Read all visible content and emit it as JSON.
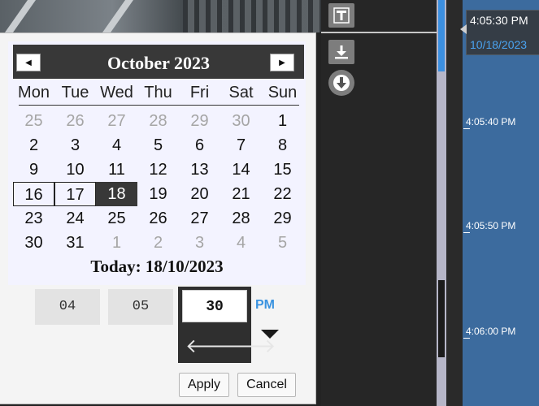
{
  "calendar": {
    "month_title": "October 2023",
    "prev_symbol": "◀",
    "next_symbol": "▶",
    "weekdays": [
      "Mon",
      "Tue",
      "Wed",
      "Thu",
      "Fri",
      "Sat",
      "Sun"
    ],
    "weeks": [
      [
        {
          "d": "25",
          "o": true
        },
        {
          "d": "26",
          "o": true
        },
        {
          "d": "27",
          "o": true
        },
        {
          "d": "28",
          "o": true
        },
        {
          "d": "29",
          "o": true
        },
        {
          "d": "30",
          "o": true
        },
        {
          "d": "1"
        }
      ],
      [
        {
          "d": "2"
        },
        {
          "d": "3"
        },
        {
          "d": "4"
        },
        {
          "d": "5"
        },
        {
          "d": "6"
        },
        {
          "d": "7"
        },
        {
          "d": "8"
        }
      ],
      [
        {
          "d": "9"
        },
        {
          "d": "10"
        },
        {
          "d": "11"
        },
        {
          "d": "12"
        },
        {
          "d": "13"
        },
        {
          "d": "14"
        },
        {
          "d": "15"
        }
      ],
      [
        {
          "d": "16",
          "h": true
        },
        {
          "d": "17",
          "h": true
        },
        {
          "d": "18",
          "s": true
        },
        {
          "d": "19"
        },
        {
          "d": "20"
        },
        {
          "d": "21"
        },
        {
          "d": "22"
        }
      ],
      [
        {
          "d": "23"
        },
        {
          "d": "24"
        },
        {
          "d": "25"
        },
        {
          "d": "26"
        },
        {
          "d": "27"
        },
        {
          "d": "28"
        },
        {
          "d": "29"
        }
      ],
      [
        {
          "d": "30"
        },
        {
          "d": "31"
        },
        {
          "d": "1",
          "o": true
        },
        {
          "d": "2",
          "o": true
        },
        {
          "d": "3",
          "o": true
        },
        {
          "d": "4",
          "o": true
        },
        {
          "d": "5",
          "o": true
        }
      ]
    ],
    "today_label": "Today: 18/10/2023"
  },
  "time": {
    "hour": "04",
    "minute": "05",
    "second": "30",
    "ampm": "PM",
    "left_arrow": "🡐",
    "right_arrow": "🡒"
  },
  "buttons": {
    "apply": "Apply",
    "cancel": "Cancel"
  },
  "timeline": {
    "cursor_time": "4:05:30 PM",
    "cursor_date": "10/18/2023",
    "ticks": [
      "4:05:40 PM",
      "4:05:50 PM",
      "4:06:00 PM"
    ]
  },
  "toolbar": {
    "icons": [
      "text-tool-icon",
      "export-icon",
      "download-icon"
    ]
  },
  "colors": {
    "accent": "#3a93e0",
    "timeline": "#3c6b9e",
    "selected": "#383838"
  }
}
